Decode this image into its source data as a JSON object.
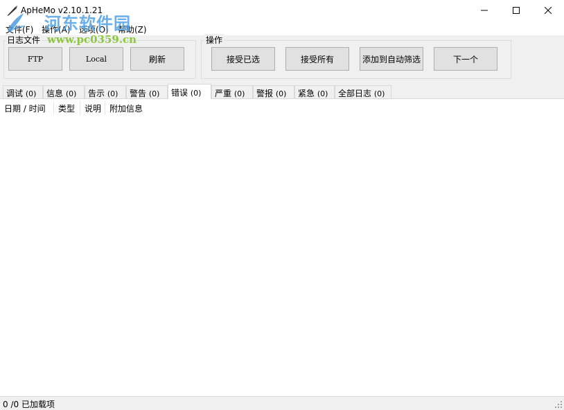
{
  "window": {
    "title": "ApHeMo v2.10.1.21",
    "controls": [
      "minimize",
      "maximize",
      "close"
    ]
  },
  "watermark": {
    "text": "河东软件园",
    "url": "www.pc0359.cn"
  },
  "menu": {
    "items": [
      {
        "label": "文件(F)"
      },
      {
        "label": "操作(A)"
      },
      {
        "label": "选项(O)"
      },
      {
        "label": "帮助(Z)"
      }
    ]
  },
  "log_files_group": {
    "label": "日志文件",
    "buttons": [
      {
        "label": "FTP"
      },
      {
        "label": "Local"
      },
      {
        "label": "刷新"
      }
    ]
  },
  "actions_group": {
    "label": "操作",
    "buttons": [
      {
        "label": "接受已选"
      },
      {
        "label": "接受所有"
      },
      {
        "label": "添加到自动筛选"
      },
      {
        "label": "下一个"
      }
    ]
  },
  "tabs": [
    {
      "label": "调试",
      "count": "(0)"
    },
    {
      "label": "信息",
      "count": "(0)"
    },
    {
      "label": "告示",
      "count": "(0)"
    },
    {
      "label": "警告",
      "count": "(0)"
    },
    {
      "label": "错误",
      "count": "(0)",
      "active": true
    },
    {
      "label": "严重",
      "count": "(0)"
    },
    {
      "label": "警报",
      "count": "(0)"
    },
    {
      "label": "紧急",
      "count": "(0)"
    },
    {
      "label": "全部日志",
      "count": "(0)"
    }
  ],
  "list": {
    "columns": [
      "日期 / 时间",
      "类型",
      "说明",
      "附加信息"
    ],
    "rows": []
  },
  "status": {
    "text": "0 /0 已加载项"
  }
}
